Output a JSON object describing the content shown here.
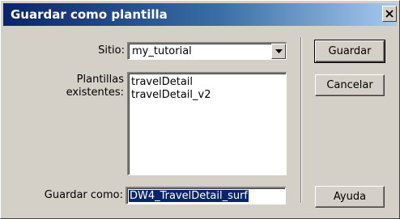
{
  "window": {
    "title": "Guardar como plantilla"
  },
  "form": {
    "site_label": "Sitio:",
    "site_value": "my_tutorial",
    "templates_label_line1": "Plantillas",
    "templates_label_line2": "existentes:",
    "existing_templates": [
      "travelDetail",
      "travelDetail_v2"
    ],
    "save_as_label": "Guardar como:",
    "save_as_value": "DW4_TravelDetail_surf"
  },
  "buttons": {
    "save": "Guardar",
    "cancel": "Cancelar",
    "help": "Ayuda"
  },
  "icons": {
    "close": "close-icon",
    "dropdown": "chevron-down-icon"
  }
}
